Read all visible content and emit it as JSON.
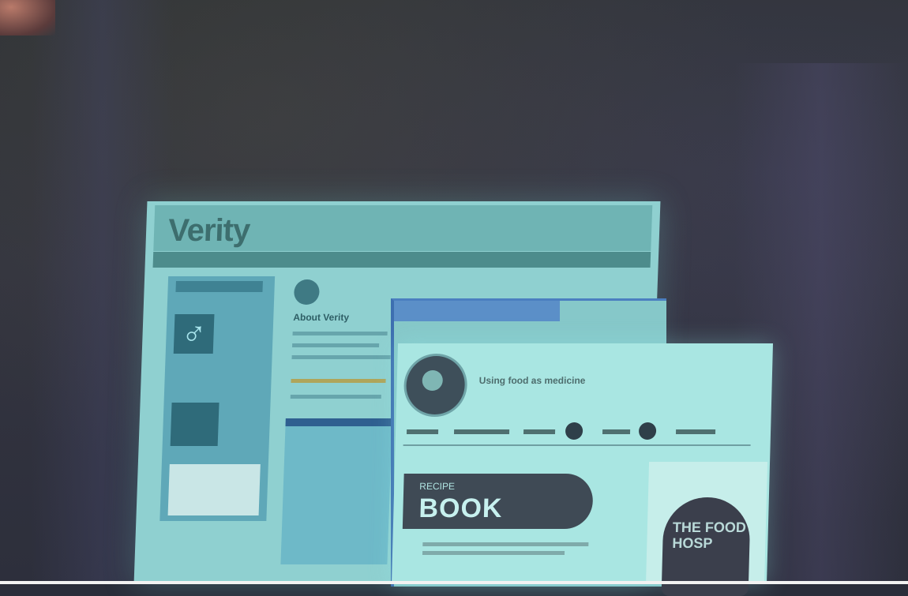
{
  "scene": {
    "description_colors": {
      "backdrop": "#2d2f3c",
      "screen_glow": "#a9e6e2",
      "dark_accent": "#3f4a55"
    }
  },
  "back_window": {
    "logo_text": "Verity",
    "about_heading": "About Verity",
    "male_symbol": "♂"
  },
  "front_window": {
    "site_title": "Using food as medicine",
    "recipe_label_small": "RECIPE",
    "recipe_label_big": "BOOK",
    "side_image_text": "THE FOOD HOSP"
  }
}
